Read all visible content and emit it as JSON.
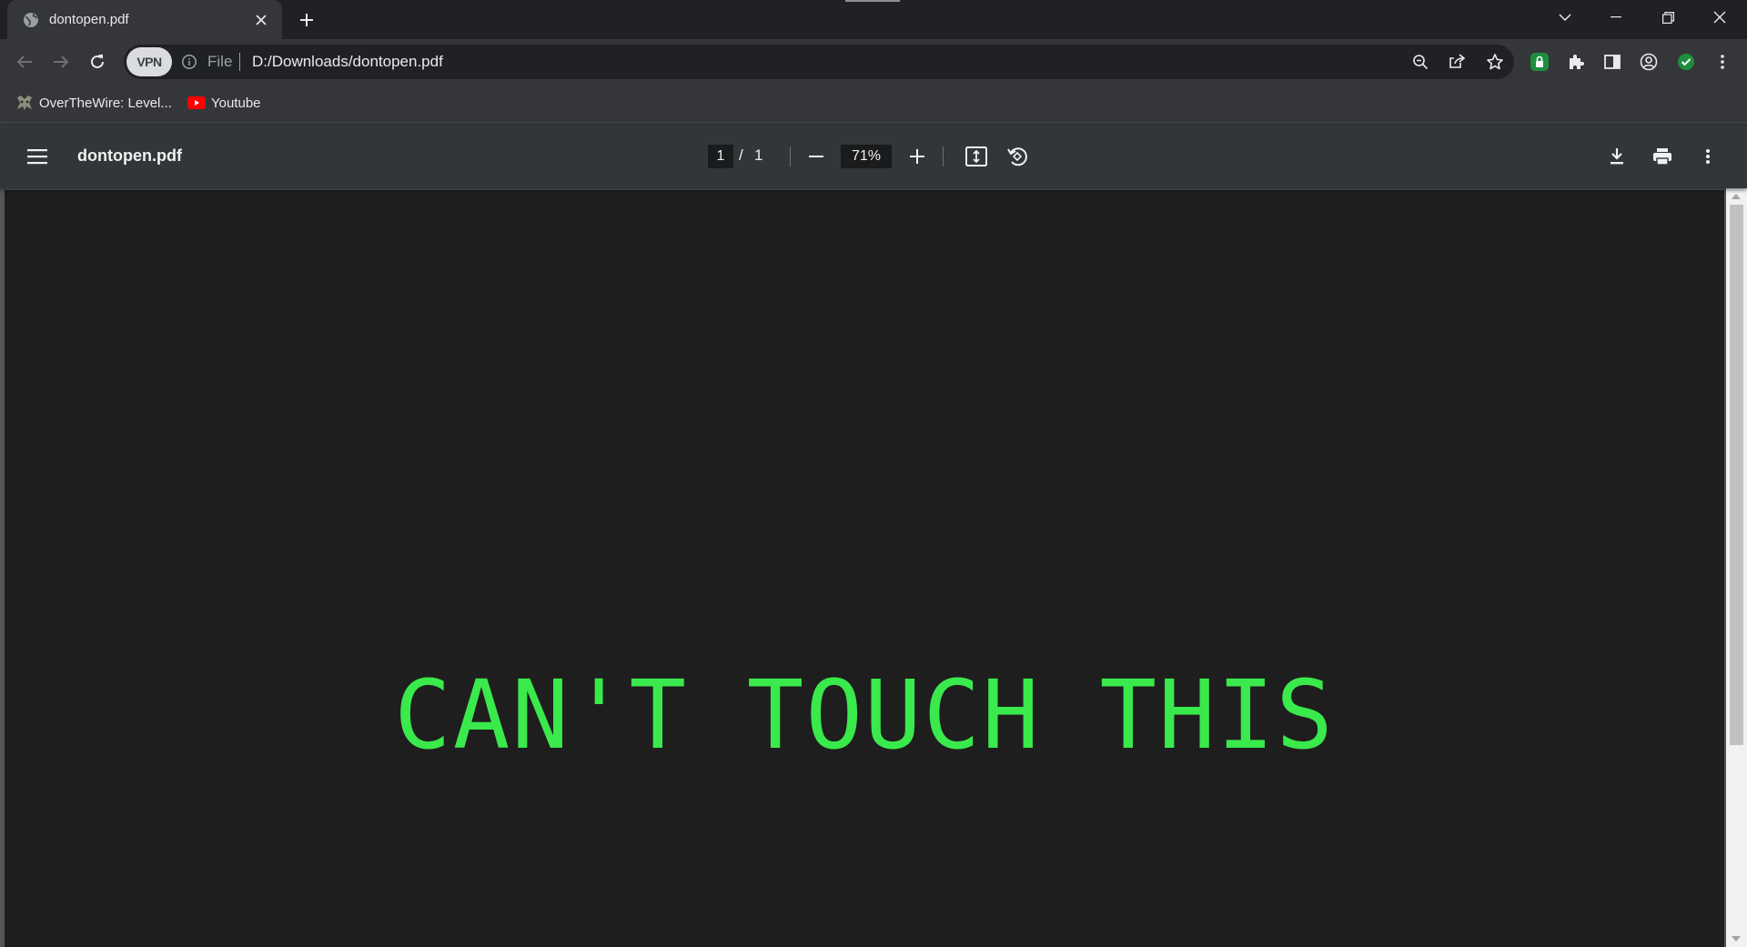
{
  "browser": {
    "tab": {
      "title": "dontopen.pdf"
    },
    "omnibox": {
      "vpn_label": "VPN",
      "scheme_label": "File",
      "url": "D:/Downloads/dontopen.pdf"
    },
    "bookmarks": [
      {
        "label": "OverTheWire: Level..."
      },
      {
        "label": "Youtube"
      }
    ]
  },
  "pdf_viewer": {
    "title": "dontopen.pdf",
    "current_page": "1",
    "page_separator": "/",
    "total_pages": "1",
    "zoom": "71%"
  },
  "document": {
    "text": "CAN'T TOUCH THIS",
    "text_color": "#3ae94b",
    "page_background": "#1e1e1e"
  }
}
